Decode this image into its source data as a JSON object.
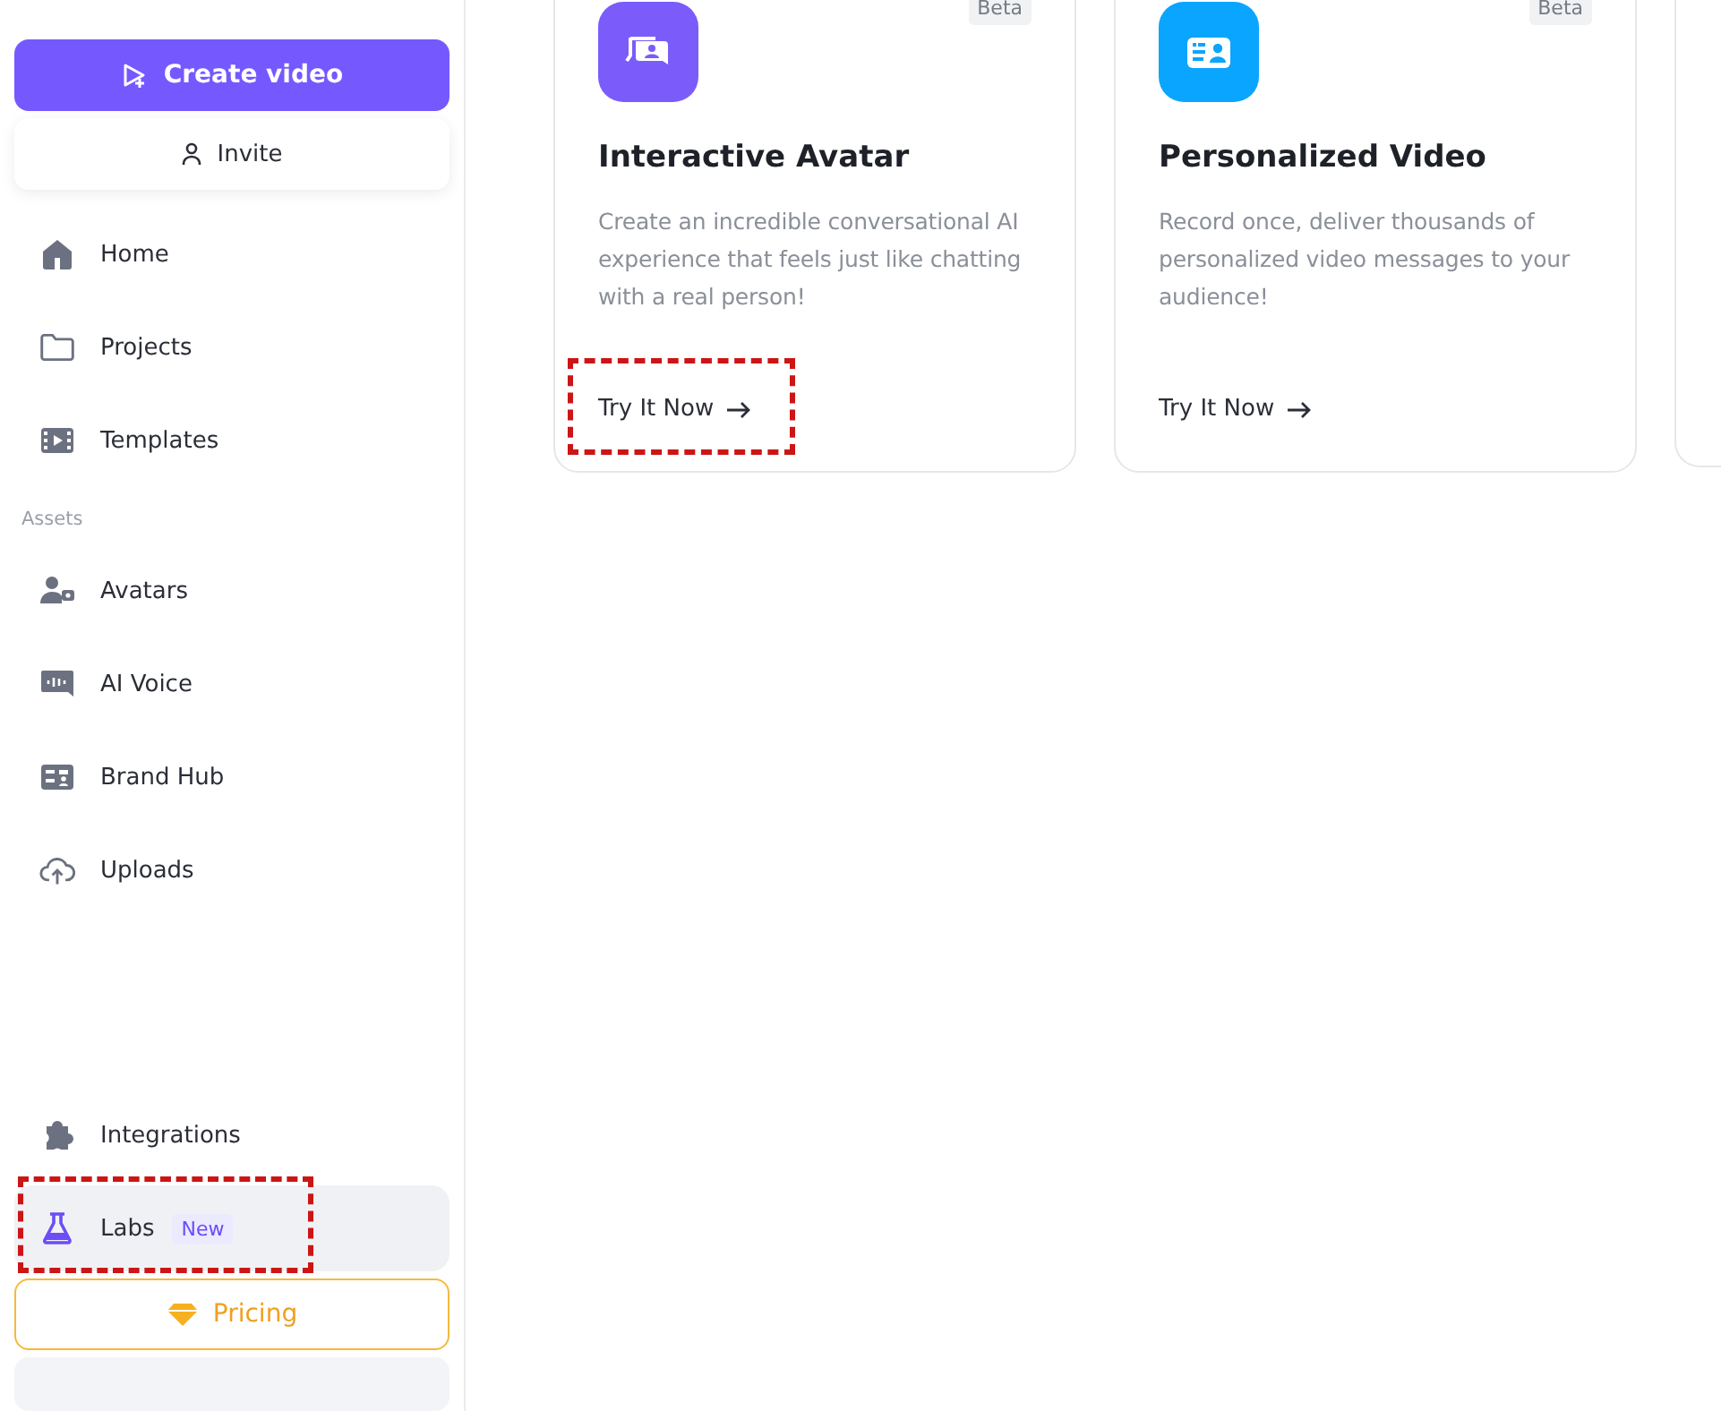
{
  "sidebar": {
    "create_button": "Create video",
    "invite_button": "Invite",
    "nav_top": [
      {
        "label": "Home",
        "kind": "home",
        "selected": false,
        "highlighted": false
      },
      {
        "label": "Projects",
        "kind": "folder",
        "selected": false,
        "highlighted": false
      },
      {
        "label": "Templates",
        "kind": "film",
        "selected": false,
        "highlighted": false
      }
    ],
    "assets": {
      "label": "Assets",
      "items": [
        {
          "label": "Avatars",
          "kind": "avatar",
          "selected": false,
          "highlighted": false
        },
        {
          "label": "AI Voice",
          "kind": "voice",
          "selected": false,
          "highlighted": false
        },
        {
          "label": "Brand Hub",
          "kind": "brand",
          "selected": false,
          "highlighted": false
        },
        {
          "label": "Uploads",
          "kind": "upload",
          "selected": false,
          "highlighted": false
        }
      ]
    },
    "nav_bottom": [
      {
        "label": "Integrations",
        "kind": "puzzle",
        "selected": false,
        "highlighted": false
      },
      {
        "label": "Labs",
        "kind": "flask",
        "badge": "New",
        "selected": true,
        "highlighted": true
      }
    ],
    "pricing_button": "Pricing"
  },
  "cards": [
    {
      "kind": "chat",
      "color": "#7b5cfa",
      "badge": "Beta",
      "title": "Interactive Avatar",
      "description": "Create an incredible conversational AI experience that feels just like chatting with a real person!",
      "link": "Try It Now",
      "highlighted": true
    },
    {
      "kind": "card",
      "color": "#0aa5ff",
      "badge": "Beta",
      "title": "Personalized Video",
      "description": "Record once, deliver thousands of personalized video messages to your audience!",
      "link": "Try It Now",
      "highlighted": false
    }
  ]
}
